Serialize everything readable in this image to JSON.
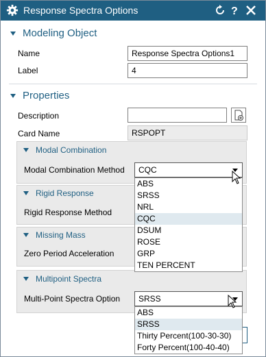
{
  "window": {
    "title": "Response Spectra Options"
  },
  "icons": {
    "gear": "gear-icon",
    "reset": "reset-icon",
    "help": "help-icon",
    "close": "close-icon",
    "add_description": "add-description-icon",
    "chevron": "chevron-down-icon",
    "cursor": "mouse-cursor-icon"
  },
  "colors": {
    "titlebar": "#1f5f82",
    "section_header": "#1f5f82",
    "selected_option": "#dfe9ef",
    "group_bg": "#eaeaea"
  },
  "modeling_object": {
    "header": "Modeling Object",
    "name_label": "Name",
    "name_value": "Response Spectra Options1",
    "label_label": "Label",
    "label_value": "4"
  },
  "properties": {
    "header": "Properties",
    "description_label": "Description",
    "description_value": "",
    "card_name_label": "Card Name",
    "card_name_value": "RSPOPT"
  },
  "modal_combination": {
    "header": "Modal Combination",
    "method_label": "Modal Combination Method",
    "method_value": "CQC",
    "options": [
      "ABS",
      "SRSS",
      "NRL",
      "CQC",
      "DSUM",
      "ROSE",
      "GRP",
      "TEN PERCENT"
    ],
    "selected_index": 3
  },
  "rigid_response": {
    "header": "Rigid Response",
    "method_label": "Rigid Response Method"
  },
  "missing_mass": {
    "header": "Missing Mass",
    "zpa_label": "Zero Period Acceleration"
  },
  "multipoint_spectra": {
    "header": "Multipoint Spectra",
    "option_label": "Multi-Point Spectra Option",
    "option_value": "SRSS",
    "options": [
      "ABS",
      "SRSS",
      "Thirty Percent(100-30-30)",
      "Forty Percent(100-40-40)"
    ],
    "selected_index": 1
  }
}
